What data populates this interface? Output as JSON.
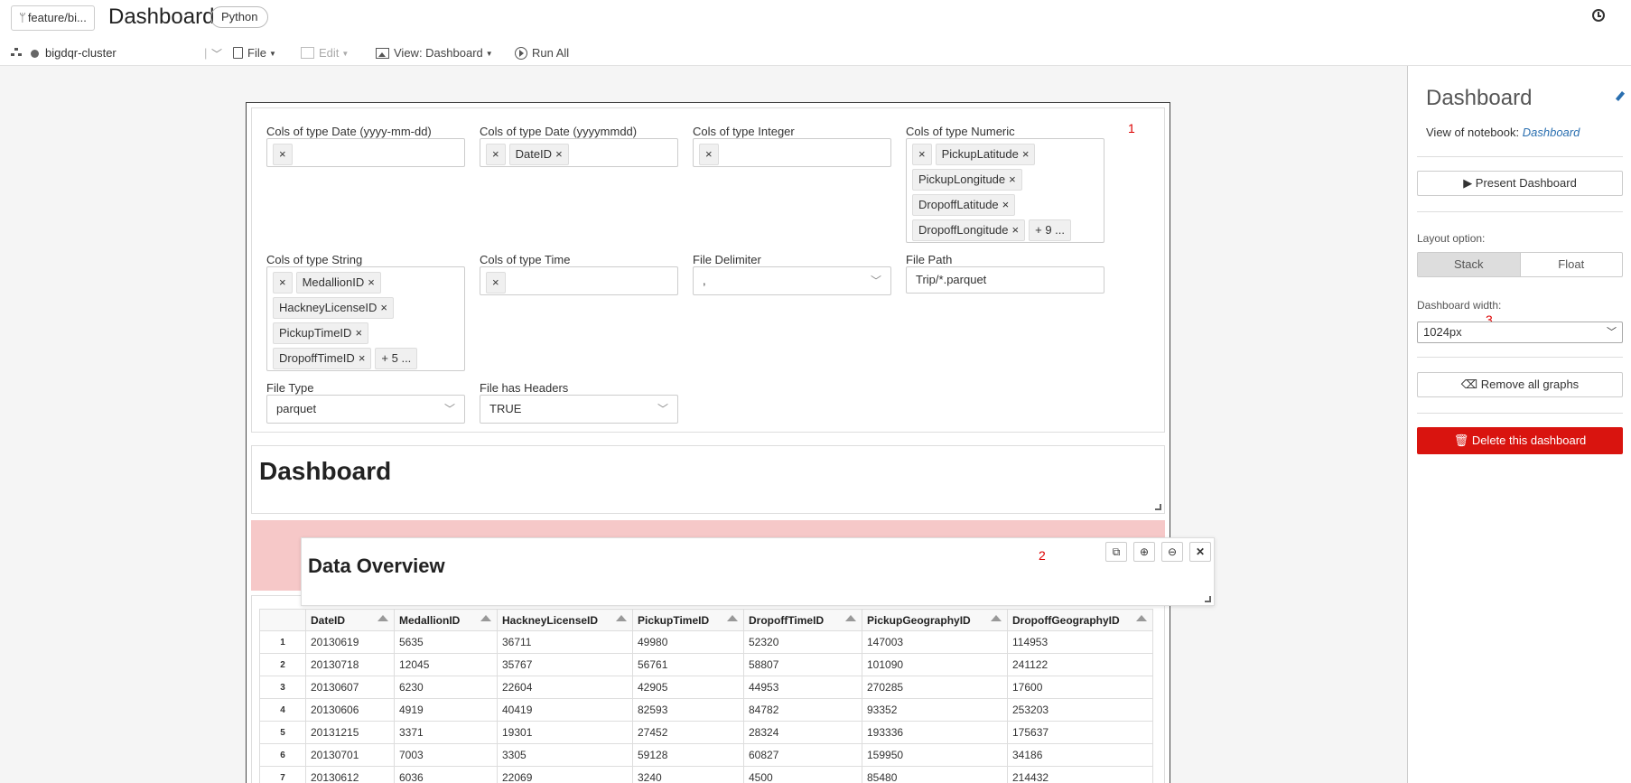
{
  "header": {
    "branch": "feature/bi...",
    "notebook_title": "Dashboard",
    "language": "Python",
    "cluster": "bigdqr-cluster",
    "menu": {
      "file": "File",
      "edit": "Edit",
      "view": "View: Dashboard",
      "run_all": "Run All"
    }
  },
  "widgets": {
    "date_dash": {
      "label": "Cols of type Date (yyyy-mm-dd)",
      "chips": []
    },
    "date_compact": {
      "label": "Cols of type Date (yyyymmdd)",
      "chips": [
        "DateID"
      ]
    },
    "integer": {
      "label": "Cols of type Integer",
      "chips": []
    },
    "numeric": {
      "label": "Cols of type Numeric",
      "chips": [
        "PickupLatitude",
        "PickupLongitude",
        "DropoffLatitude",
        "DropoffLongitude"
      ],
      "more": "+ 9 ..."
    },
    "string": {
      "label": "Cols of type String",
      "chips": [
        "MedallionID",
        "HackneyLicenseID",
        "PickupTimeID",
        "DropoffTimeID"
      ],
      "more": "+ 5 ..."
    },
    "time": {
      "label": "Cols of type Time",
      "chips": []
    },
    "delimiter": {
      "label": "File Delimiter",
      "value": ","
    },
    "path": {
      "label": "File Path",
      "value": "Trip/*.parquet"
    },
    "file_type": {
      "label": "File Type",
      "value": "parquet"
    },
    "headers": {
      "label": "File has Headers",
      "value": "TRUE"
    },
    "clear_symbol": "×"
  },
  "annotations": {
    "one": "1",
    "two": "2",
    "three": "3"
  },
  "markdown_title": "Dashboard",
  "overview": {
    "title": "Data Overview"
  },
  "table": {
    "columns": [
      "DateID",
      "MedallionID",
      "HackneyLicenseID",
      "PickupTimeID",
      "DropoffTimeID",
      "PickupGeographyID",
      "DropoffGeographyID"
    ],
    "rows": [
      [
        "1",
        "20130619",
        "5635",
        "36711",
        "49980",
        "52320",
        "147003",
        "114953"
      ],
      [
        "2",
        "20130718",
        "12045",
        "35767",
        "56761",
        "58807",
        "101090",
        "241122"
      ],
      [
        "3",
        "20130607",
        "6230",
        "22604",
        "42905",
        "44953",
        "270285",
        "17600"
      ],
      [
        "4",
        "20130606",
        "4919",
        "40419",
        "82593",
        "84782",
        "93352",
        "253203"
      ],
      [
        "5",
        "20131215",
        "3371",
        "19301",
        "27452",
        "28324",
        "193336",
        "175637"
      ],
      [
        "6",
        "20130701",
        "7003",
        "3305",
        "59128",
        "60827",
        "159950",
        "34186"
      ],
      [
        "7",
        "20130612",
        "6036",
        "22069",
        "3240",
        "4500",
        "85480",
        "214432"
      ]
    ]
  },
  "sidebar": {
    "title": "Dashboard",
    "view_of_prefix": "View of notebook: ",
    "view_of_link": "Dashboard",
    "present_button": "▶ Present Dashboard",
    "layout_label": "Layout option:",
    "layout_options": [
      "Stack",
      "Float"
    ],
    "width_label": "Dashboard width:",
    "width_value": "1024px",
    "remove_button": "Remove all graphs",
    "delete_button": "Delete this dashboard"
  }
}
